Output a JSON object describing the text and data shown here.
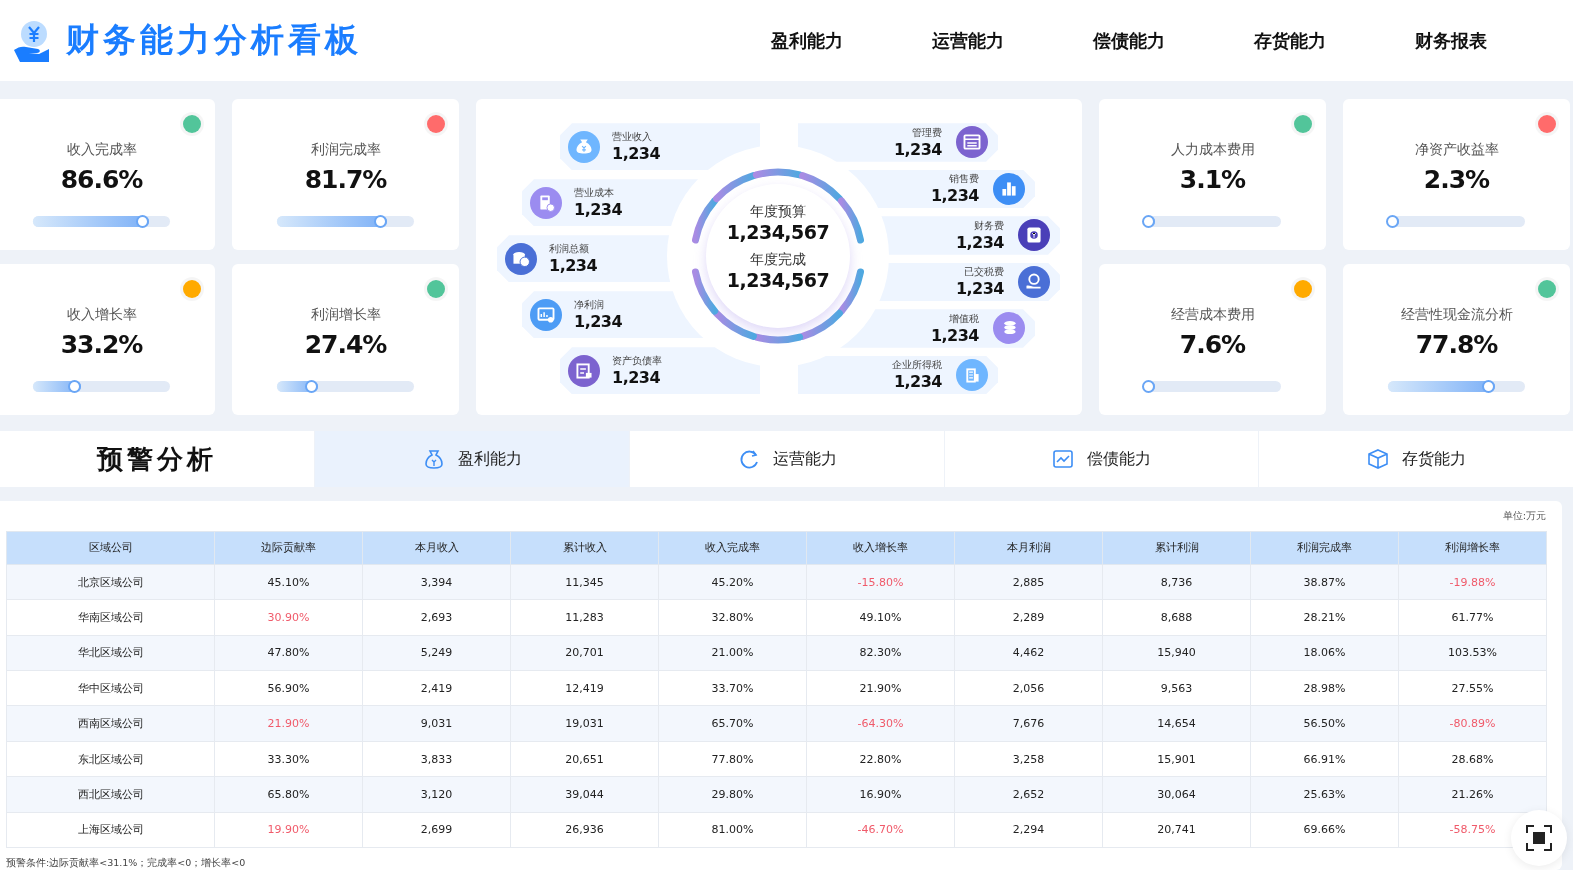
{
  "header": {
    "title": "财务能力分析看板",
    "nav": [
      {
        "label": "盈利能力"
      },
      {
        "label": "运营能力"
      },
      {
        "label": "偿债能力"
      },
      {
        "label": "存货能力"
      },
      {
        "label": "财务报表"
      }
    ]
  },
  "kpis_left": [
    {
      "label": "收入完成率",
      "value": "86.6%",
      "level": 0.85,
      "color": "#52c59a"
    },
    {
      "label": "利润完成率",
      "value": "81.7%",
      "level": 0.8,
      "color": "#ff6b6b"
    },
    {
      "label": "收入增长率",
      "value": "33.2%",
      "level": 0.35,
      "color": "#ffaa00"
    },
    {
      "label": "利润增长率",
      "value": "27.4%",
      "level": 0.3,
      "color": "#52c59a"
    }
  ],
  "center": {
    "budget_label": "年度预算",
    "budget_value": "1,234,567",
    "done_label": "年度完成",
    "done_value": "1,234,567",
    "left": [
      {
        "label": "营业收入",
        "value": "1,234",
        "color": "#6fb6ff"
      },
      {
        "label": "营业成本",
        "value": "1,234",
        "color": "#9b8cf0"
      },
      {
        "label": "利润总额",
        "value": "1,234",
        "color": "#4a6fd6"
      },
      {
        "label": "净利润",
        "value": "1,234",
        "color": "#4d9cf5"
      },
      {
        "label": "资产负债率",
        "value": "1,234",
        "color": "#7c63cf"
      }
    ],
    "right": [
      {
        "label": "管理费",
        "value": "1,234",
        "color": "#7c63cf"
      },
      {
        "label": "销售费",
        "value": "1,234",
        "color": "#3d8ef5"
      },
      {
        "label": "财务费",
        "value": "1,234",
        "color": "#4a3fb8"
      },
      {
        "label": "已交税费",
        "value": "1,234",
        "color": "#4a6fd6"
      },
      {
        "label": "增值税",
        "value": "1,234",
        "color": "#9b8cf0"
      },
      {
        "label": "企业所得税",
        "value": "1,234",
        "color": "#6fb6ff"
      }
    ]
  },
  "kpis_right": [
    {
      "label": "人力成本费用",
      "value": "3.1%",
      "level": 0.04,
      "color": "#52c59a"
    },
    {
      "label": "净资产收益率",
      "value": "2.3%",
      "level": 0.03,
      "color": "#ff6b6b"
    },
    {
      "label": "经营成本费用",
      "value": "7.6%",
      "level": 0.08,
      "color": "#ffaa00"
    },
    {
      "label": "经营性现金流分析",
      "value": "77.8%",
      "level": 0.78,
      "color": "#52c59a"
    }
  ],
  "warning": {
    "title": "预警分析",
    "tabs": [
      {
        "label": "盈利能力",
        "selected": true
      },
      {
        "label": "运营能力",
        "selected": false
      },
      {
        "label": "偿债能力",
        "selected": false
      },
      {
        "label": "存货能力",
        "selected": false
      }
    ]
  },
  "table": {
    "unit": "单位:万元",
    "columns": [
      "区域公司",
      "边际贡献率",
      "本月收入",
      "累计收入",
      "收入完成率",
      "收入增长率",
      "本月利润",
      "累计利润",
      "利润完成率",
      "利润增长率"
    ],
    "rows": [
      {
        "cells": [
          {
            "text": "北京区域公司",
            "warn": false
          },
          {
            "text": "45.10%",
            "warn": false
          },
          {
            "text": "3,394",
            "warn": false
          },
          {
            "text": "11,345",
            "warn": false
          },
          {
            "text": "45.20%",
            "warn": false
          },
          {
            "text": "-15.80%",
            "warn": true
          },
          {
            "text": "2,885",
            "warn": false
          },
          {
            "text": "8,736",
            "warn": false
          },
          {
            "text": "38.87%",
            "warn": false
          },
          {
            "text": "-19.88%",
            "warn": true
          }
        ]
      },
      {
        "cells": [
          {
            "text": "华南区域公司",
            "warn": false
          },
          {
            "text": "30.90%",
            "warn": true
          },
          {
            "text": "2,693",
            "warn": false
          },
          {
            "text": "11,283",
            "warn": false
          },
          {
            "text": "32.80%",
            "warn": false
          },
          {
            "text": "49.10%",
            "warn": false
          },
          {
            "text": "2,289",
            "warn": false
          },
          {
            "text": "8,688",
            "warn": false
          },
          {
            "text": "28.21%",
            "warn": false
          },
          {
            "text": "61.77%",
            "warn": false
          }
        ]
      },
      {
        "cells": [
          {
            "text": "华北区域公司",
            "warn": false
          },
          {
            "text": "47.80%",
            "warn": false
          },
          {
            "text": "5,249",
            "warn": false
          },
          {
            "text": "20,701",
            "warn": false
          },
          {
            "text": "21.00%",
            "warn": false
          },
          {
            "text": "82.30%",
            "warn": false
          },
          {
            "text": "4,462",
            "warn": false
          },
          {
            "text": "15,940",
            "warn": false
          },
          {
            "text": "18.06%",
            "warn": false
          },
          {
            "text": "103.53%",
            "warn": false
          }
        ]
      },
      {
        "cells": [
          {
            "text": "华中区域公司",
            "warn": false
          },
          {
            "text": "56.90%",
            "warn": false
          },
          {
            "text": "2,419",
            "warn": false
          },
          {
            "text": "12,419",
            "warn": false
          },
          {
            "text": "33.70%",
            "warn": false
          },
          {
            "text": "21.90%",
            "warn": false
          },
          {
            "text": "2,056",
            "warn": false
          },
          {
            "text": "9,563",
            "warn": false
          },
          {
            "text": "28.98%",
            "warn": false
          },
          {
            "text": "27.55%",
            "warn": false
          }
        ]
      },
      {
        "cells": [
          {
            "text": "西南区域公司",
            "warn": false
          },
          {
            "text": "21.90%",
            "warn": true
          },
          {
            "text": "9,031",
            "warn": false
          },
          {
            "text": "19,031",
            "warn": false
          },
          {
            "text": "65.70%",
            "warn": false
          },
          {
            "text": "-64.30%",
            "warn": true
          },
          {
            "text": "7,676",
            "warn": false
          },
          {
            "text": "14,654",
            "warn": false
          },
          {
            "text": "56.50%",
            "warn": false
          },
          {
            "text": "-80.89%",
            "warn": true
          }
        ]
      },
      {
        "cells": [
          {
            "text": "东北区域公司",
            "warn": false
          },
          {
            "text": "33.30%",
            "warn": false
          },
          {
            "text": "3,833",
            "warn": false
          },
          {
            "text": "20,651",
            "warn": false
          },
          {
            "text": "77.80%",
            "warn": false
          },
          {
            "text": "22.80%",
            "warn": false
          },
          {
            "text": "3,258",
            "warn": false
          },
          {
            "text": "15,901",
            "warn": false
          },
          {
            "text": "66.91%",
            "warn": false
          },
          {
            "text": "28.68%",
            "warn": false
          }
        ]
      },
      {
        "cells": [
          {
            "text": "西北区域公司",
            "warn": false
          },
          {
            "text": "65.80%",
            "warn": false
          },
          {
            "text": "3,120",
            "warn": false
          },
          {
            "text": "39,044",
            "warn": false
          },
          {
            "text": "29.80%",
            "warn": false
          },
          {
            "text": "16.90%",
            "warn": false
          },
          {
            "text": "2,652",
            "warn": false
          },
          {
            "text": "30,064",
            "warn": false
          },
          {
            "text": "25.63%",
            "warn": false
          },
          {
            "text": "21.26%",
            "warn": false
          }
        ]
      },
      {
        "cells": [
          {
            "text": "上海区域公司",
            "warn": false
          },
          {
            "text": "19.90%",
            "warn": true
          },
          {
            "text": "2,699",
            "warn": false
          },
          {
            "text": "26,936",
            "warn": false
          },
          {
            "text": "81.00%",
            "warn": false
          },
          {
            "text": "-46.70%",
            "warn": true
          },
          {
            "text": "2,294",
            "warn": false
          },
          {
            "text": "20,741",
            "warn": false
          },
          {
            "text": "69.66%",
            "warn": false
          },
          {
            "text": "-58.75%",
            "warn": true
          }
        ]
      }
    ],
    "note": "预警条件:边际贡献率<31.1%；完成率<0；增长率<0"
  }
}
